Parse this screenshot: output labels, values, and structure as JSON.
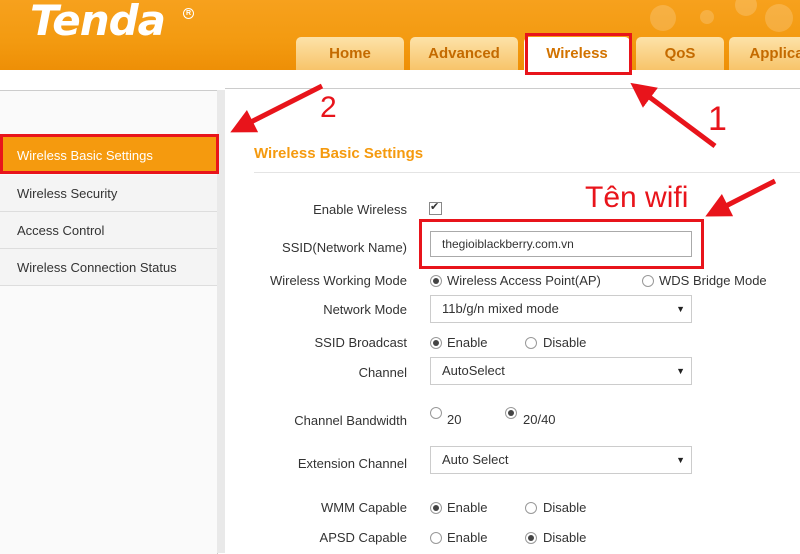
{
  "brand": {
    "logo_text": "Tenda",
    "reg_mark": "R"
  },
  "tabs": [
    {
      "label": "Home"
    },
    {
      "label": "Advanced"
    },
    {
      "label": "Wireless"
    },
    {
      "label": "QoS"
    },
    {
      "label": "Applica"
    }
  ],
  "sidebar": {
    "items": [
      {
        "label": "Wireless Basic Settings"
      },
      {
        "label": "Wireless Security"
      },
      {
        "label": "Access Control"
      },
      {
        "label": "Wireless Connection Status"
      }
    ]
  },
  "form": {
    "title": "Wireless Basic Settings",
    "enable_wireless": {
      "label": "Enable Wireless",
      "checked": true
    },
    "ssid": {
      "label": "SSID(Network Name)",
      "value": "thegioiblackberry.com.vn"
    },
    "working_mode": {
      "label": "Wireless Working Mode",
      "option1": "Wireless Access Point(AP)",
      "option2": "WDS Bridge Mode"
    },
    "network_mode": {
      "label": "Network Mode",
      "value": "11b/g/n mixed mode"
    },
    "ssid_broadcast": {
      "label": "SSID Broadcast",
      "option1": "Enable",
      "option2": "Disable"
    },
    "channel": {
      "label": "Channel",
      "value": "AutoSelect"
    },
    "bandwidth": {
      "label": "Channel Bandwidth",
      "option1": "20",
      "option2": "20/40"
    },
    "extension_channel": {
      "label": "Extension Channel",
      "value": "Auto Select"
    },
    "wmm": {
      "label": "WMM Capable",
      "option1": "Enable",
      "option2": "Disable"
    },
    "apsd": {
      "label": "APSD Capable",
      "option1": "Enable",
      "option2": "Disable"
    }
  },
  "annotations": {
    "step1": "1",
    "step2": "2",
    "wifi_name_note": "Tên wifi",
    "color": "#e8141b"
  },
  "icons": {
    "dropdown": "▼",
    "check": "✔"
  }
}
